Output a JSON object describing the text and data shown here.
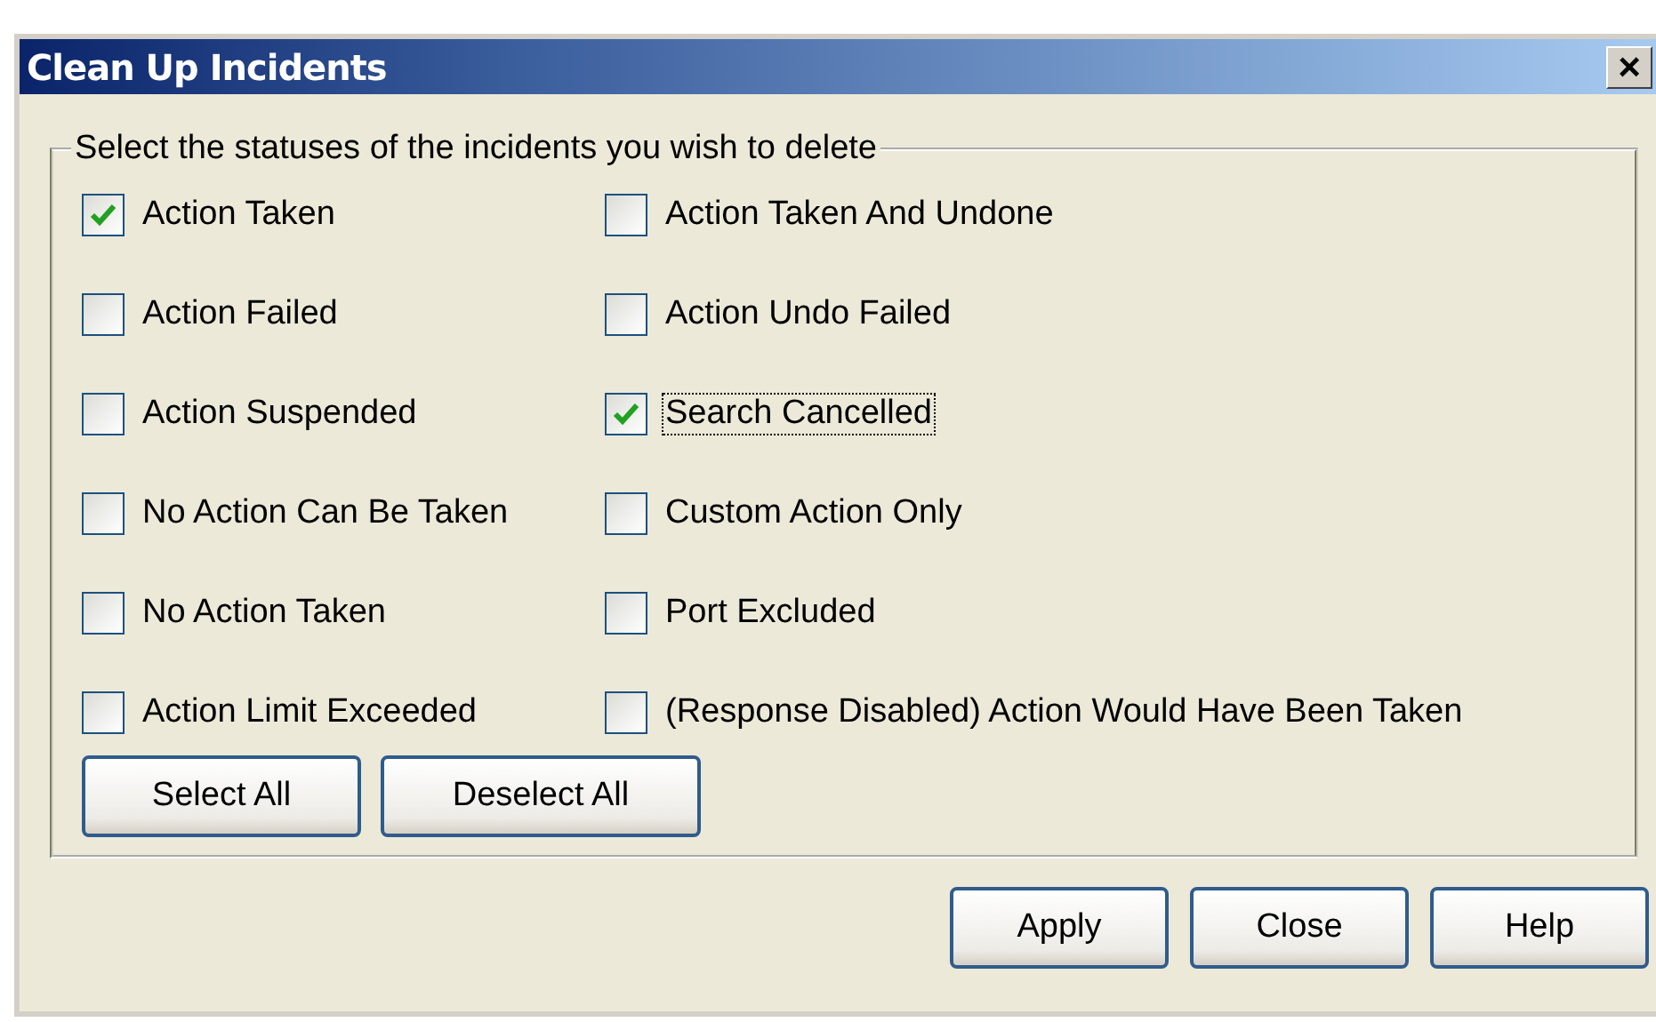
{
  "window": {
    "title": "Clean Up Incidents",
    "close_glyph": "×"
  },
  "group": {
    "legend": "Select the statuses of the incidents you wish to delete"
  },
  "statuses": [
    {
      "label": "Action Taken",
      "checked": true,
      "focused": false
    },
    {
      "label": "Action Taken And Undone",
      "checked": false,
      "focused": false
    },
    {
      "label": "Action Failed",
      "checked": false,
      "focused": false
    },
    {
      "label": "Action Undo Failed",
      "checked": false,
      "focused": false
    },
    {
      "label": "Action Suspended",
      "checked": false,
      "focused": false
    },
    {
      "label": "Search Cancelled",
      "checked": true,
      "focused": true
    },
    {
      "label": "No Action Can Be Taken",
      "checked": false,
      "focused": false
    },
    {
      "label": "Custom Action Only",
      "checked": false,
      "focused": false
    },
    {
      "label": "No Action Taken",
      "checked": false,
      "focused": false
    },
    {
      "label": "Port Excluded",
      "checked": false,
      "focused": false
    },
    {
      "label": "Action Limit Exceeded",
      "checked": false,
      "focused": false
    },
    {
      "label": "(Response Disabled) Action Would Have Been Taken",
      "checked": false,
      "focused": false
    }
  ],
  "group_buttons": [
    "Select All",
    "Deselect All"
  ],
  "buttons": [
    "Apply",
    "Close",
    "Help"
  ]
}
